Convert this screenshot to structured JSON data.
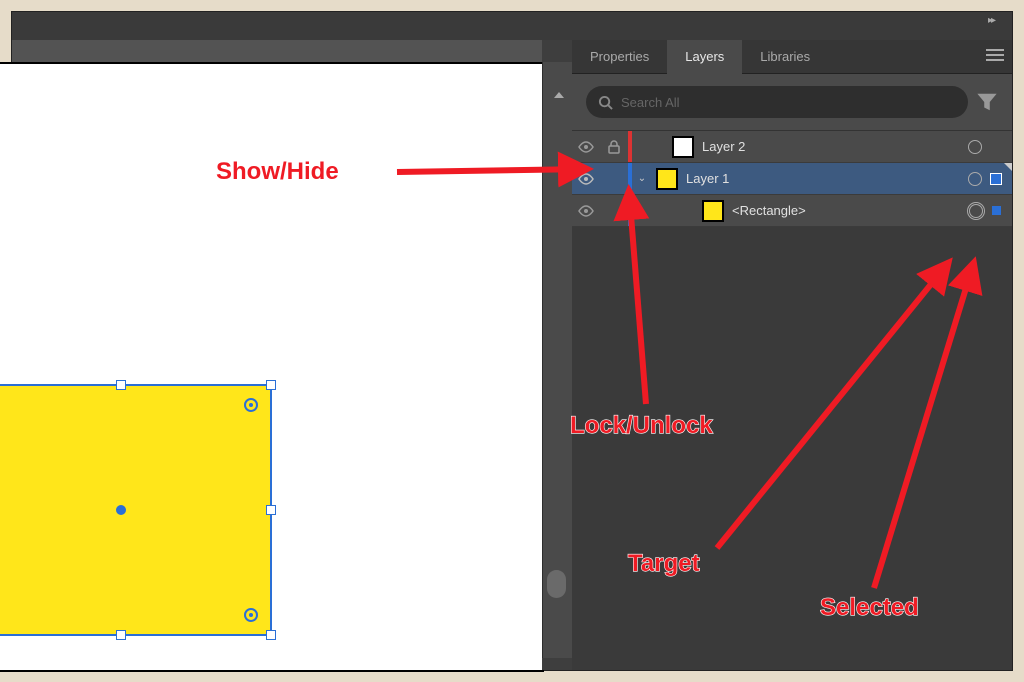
{
  "panel": {
    "tabs": [
      "Properties",
      "Layers",
      "Libraries"
    ],
    "active_tab_index": 1,
    "search_placeholder": "Search All"
  },
  "layers": [
    {
      "name": "Layer 2",
      "thumb": "white",
      "color": "red",
      "visible": true,
      "locked": true,
      "selected": false,
      "targeted": false,
      "expanded": false,
      "depth": 0
    },
    {
      "name": "Layer 1",
      "thumb": "yellow",
      "color": "blue",
      "visible": true,
      "locked": false,
      "selected": true,
      "targeted": false,
      "expanded": true,
      "depth": 0,
      "row_highlight": true
    },
    {
      "name": "<Rectangle>",
      "thumb": "yellow",
      "color": "blue",
      "visible": true,
      "locked": false,
      "selected": true,
      "targeted": true,
      "expanded": false,
      "depth": 1
    }
  ],
  "annotations": {
    "show_hide": "Show/Hide",
    "lock_unlock": "Lock/Unlock",
    "target": "Target",
    "selected": "Selected"
  },
  "canvas": {
    "rectangle_fill": "#ffe61a",
    "rectangle_selected": true
  }
}
